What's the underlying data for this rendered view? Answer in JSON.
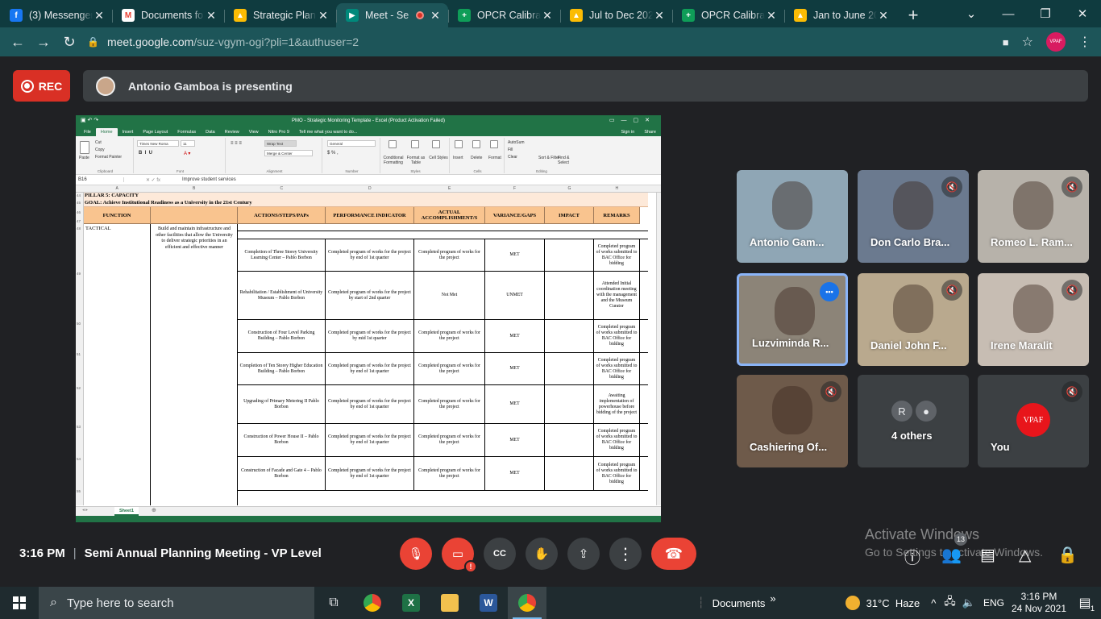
{
  "browser": {
    "tabs": [
      {
        "label": "(3) Messenger",
        "icon": "facebook-icon",
        "color": "#1877f2",
        "glyph": "f"
      },
      {
        "label": "Documents fo",
        "icon": "gmail-icon",
        "color": "#ffffff",
        "glyph": "M"
      },
      {
        "label": "Strategic Plan",
        "icon": "google-drive-icon",
        "color": "#fbbc04",
        "glyph": "▲"
      },
      {
        "label": "Meet - Se",
        "icon": "google-meet-icon",
        "color": "#00897b",
        "glyph": "▶",
        "active": true
      },
      {
        "label": "OPCR Calibrat",
        "icon": "google-sheets-icon",
        "color": "#0f9d58",
        "glyph": "+"
      },
      {
        "label": "Jul to Dec 202",
        "icon": "google-drive-icon",
        "color": "#fbbc04",
        "glyph": "▲"
      },
      {
        "label": "OPCR Calibrat",
        "icon": "google-sheets-icon",
        "color": "#0f9d58",
        "glyph": "+"
      },
      {
        "label": "Jan to June 20",
        "icon": "google-drive-icon",
        "color": "#fbbc04",
        "glyph": "▲"
      }
    ],
    "url_host": "meet.google.com",
    "url_path": "/suz-vgym-ogi?pli=1&authuser=2",
    "profile_label": "VPAF"
  },
  "meet": {
    "rec_label": "REC",
    "presenting_text": "Antonio Gamboa is presenting",
    "time": "3:16 PM",
    "separator": "|",
    "meeting_title": "Semi Annual Planning Meeting - VP Level",
    "people_count": "13",
    "activate_title": "Activate Windows",
    "activate_sub": "Go to Settings to activate Windows."
  },
  "participants": [
    {
      "name": "Antonio Gam...",
      "muted": false,
      "bg": "#8fa6b5"
    },
    {
      "name": "Don Carlo Bra...",
      "muted": true,
      "bg": "#6b7a8f"
    },
    {
      "name": "Romeo L. Ram...",
      "muted": true,
      "bg": "#b7b2aa"
    },
    {
      "name": "Luzviminda R...",
      "muted": false,
      "bg": "#8c8478"
    },
    {
      "name": "Daniel John F...",
      "muted": true,
      "bg": "#b9a98e"
    },
    {
      "name": "Irene Maralit",
      "muted": true,
      "bg": "#c7bdb3"
    },
    {
      "name": "Cashiering Of...",
      "muted": true,
      "bg": "#6e5a4a"
    },
    {
      "name": "4 others",
      "muted": false,
      "bg": "#3c4043"
    },
    {
      "name": "You",
      "muted": true,
      "bg": "#3c4043"
    }
  ],
  "others_avatars": [
    "R",
    "●"
  ],
  "you_avatar": "VPAF",
  "excel": {
    "window_title": "PMO - Strategic Monitoring Template - Excel (Product Activation Failed)",
    "signin": "Sign in",
    "share": "Share",
    "menu": [
      "File",
      "Home",
      "Insert",
      "Page Layout",
      "Formulas",
      "Data",
      "Review",
      "View",
      "Nitro Pro 9",
      "Tell me what you want to do..."
    ],
    "ribbon": {
      "clipboard": "Clipboard",
      "font": "Font",
      "alignment": "Alignment",
      "number": "Number",
      "styles": "Styles",
      "cells": "Cells",
      "editing": "Editing",
      "paste": "Paste",
      "cut": "Cut",
      "copy": "Copy",
      "format_painter": "Format Painter",
      "font_name": "Times New Roma",
      "font_size": "11",
      "wrap_text": "Wrap Text",
      "merge_center": "Merge & Center",
      "number_format": "General",
      "cond_format": "Conditional Formatting",
      "format_table": "Format as Table",
      "cell_styles": "Cell Styles",
      "insert": "Insert",
      "delete": "Delete",
      "format": "Format",
      "autosum": "AutoSum",
      "fill": "Fill",
      "clear": "Clear",
      "sort_filter": "Sort & Filter",
      "find_select": "Find & Select"
    },
    "name_box": "B16",
    "formula": "Improve student services",
    "columns": [
      "A",
      "B",
      "C",
      "D",
      "E",
      "F",
      "G",
      "H"
    ],
    "row_numbers": [
      "44",
      "45",
      "46",
      "47",
      "48",
      "49",
      "50",
      "51",
      "52",
      "53",
      "54",
      "55"
    ],
    "pillar": "PILLAR 5: CAPACITY",
    "goal": "GOAL: Achieve Institutional Readiness as a University in the 21st Century",
    "headers": [
      "FUNCTION",
      "",
      "ACTIONS/STEPS/PAPs",
      "PERFORMANCE INDICATOR",
      "ACTUAL ACCOMPLISHMENT/S",
      "VARIANCE/GAPS",
      "IMPACT",
      "REMARKS"
    ],
    "function_label": "TACTICAL",
    "objective": "Build and maintain infrastructure and other facilities that allow the University to deliver strategic priorities in an efficient and effective manner",
    "rows": [
      {
        "action": "Completion of Three Storey University Learning Center – Pablo Borbon",
        "indicator": "Completed program of works for the project by end of 1st quarter",
        "actual": "Completed program of works for the project",
        "variance": "MET",
        "remarks": "Completed program of works submitted to BAC Office for bidding"
      },
      {
        "action": "Rehabilitation / Establishment of University Museum – Pablo Borbon",
        "indicator": "Completed program of works for the project by start of 2nd quarter",
        "actual": "Not Met",
        "variance": "UNMET",
        "remarks": "Attended Initial coordination meeting with the management and the Museum Curator"
      },
      {
        "action": "Construction of Four Level Parking Building – Pablo Borbon",
        "indicator": "Completed program of works for the project by mid 1st quarter",
        "actual": "Completed program of works for the project",
        "variance": "MET",
        "remarks": "Completed program of works submitted to BAC Office for bidding"
      },
      {
        "action": "Completion of Ten Storey Higher Education Building – Pablo Borbon",
        "indicator": "Completed program of works for the project by end of 1st quarter",
        "actual": "Completed program of works for the project",
        "variance": "MET",
        "remarks": "Completed program of works submitted to BAC Office for bidding"
      },
      {
        "action": "Upgrading of Primary Metering II Pablo Borbon",
        "indicator": "Completed program of works for the project by end of 1st quarter",
        "actual": "Completed program of works for the project",
        "variance": "MET",
        "remarks": "Awaiting implementation of powerhouse before bidding of the project"
      },
      {
        "action": "Construction of Power House II – Pablo Borbon",
        "indicator": "Completed program of works for the project by end of 1st quarter",
        "actual": "Completed program of works for the project",
        "variance": "MET",
        "remarks": "Completed program of works submitted to BAC Office for bidding"
      },
      {
        "action": "Construction of Facade and Gate 4 – Pablo Borbon",
        "indicator": "Completed program of works for the project by end of 1st quarter",
        "actual": "Completed program of works for the project",
        "variance": "MET",
        "remarks": "Completed program of works submitted to BAC Office for bidding"
      }
    ],
    "sheet_tab": "Sheet1"
  },
  "taskbar": {
    "search_placeholder": "Type here to search",
    "documents_label": "Documents",
    "chevron": "»",
    "weather": "31°C  Haze",
    "lang": "ENG",
    "time": "3:16 PM",
    "date": "24 Nov 2021",
    "notif_count": "1"
  },
  "colors": {
    "accent_red": "#ea4335",
    "chrome_teal": "#1d5559",
    "excel_green": "#217346"
  }
}
